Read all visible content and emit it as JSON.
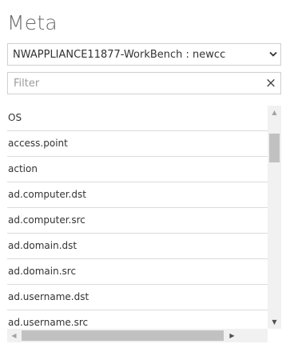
{
  "panel": {
    "title": "Meta",
    "source_select": {
      "value": "NWAPPLIANCE11877-WorkBench : newcc"
    },
    "filter": {
      "placeholder": "Filter",
      "value": "",
      "clear_glyph": "×"
    },
    "meta_keys": [
      "OS",
      "access.point",
      "action",
      "ad.computer.dst",
      "ad.computer.src",
      "ad.domain.dst",
      "ad.domain.src",
      "ad.username.dst",
      "ad.username.src"
    ],
    "scrollbars": {
      "up_glyph": "▲",
      "down_glyph": "▼",
      "left_glyph": "◀",
      "right_glyph": "▶"
    }
  },
  "icons": [
    "chevron-down-icon",
    "clear-icon",
    "scroll-up-icon",
    "scroll-down-icon",
    "scroll-left-icon",
    "scroll-right-icon"
  ]
}
